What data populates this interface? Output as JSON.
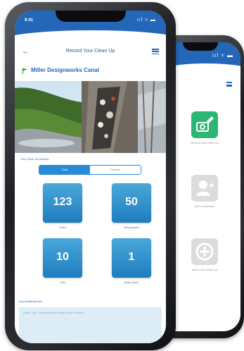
{
  "colors": {
    "brand": "#2466b8",
    "tile": "#2a8ad6",
    "green_tile": "#2bb673",
    "gray_tile": "#d9d9d9"
  },
  "front": {
    "status_time": "9:41",
    "status_icons": "ııl ≈ ▬",
    "nav": {
      "back_icon": "arrow-left-icon",
      "title": "Record Your Clean Up",
      "menu_icon": "menu-icon"
    },
    "site": {
      "flag_icon": "flag-icon",
      "name": "Miller Designworks Canal"
    },
    "photo_icon": "photo",
    "results_label": "Your Clean Up Results",
    "toggle": {
      "left": "Total",
      "right": "Pounds"
    },
    "metrics": [
      {
        "value": "123",
        "label": "Trash"
      },
      {
        "value": "50",
        "label": "Recyclables"
      },
      {
        "value": "10",
        "label": "Tires"
      },
      {
        "value": "1",
        "label": "Bulky Items"
      }
    ],
    "notes": {
      "label": "Any additional info",
      "placeholder": "Notes, tips, comments and stories about cleanup"
    }
  },
  "back": {
    "status_icons": "ııl ≈ ▬",
    "tiles": [
      {
        "icon": "camera-edit-icon",
        "label": "Record your Clean Up"
      },
      {
        "icon": "user-icon",
        "label": "Add a Volunteer"
      },
      {
        "icon": "plus-icon",
        "label": "Add a new Clean Up"
      }
    ]
  }
}
